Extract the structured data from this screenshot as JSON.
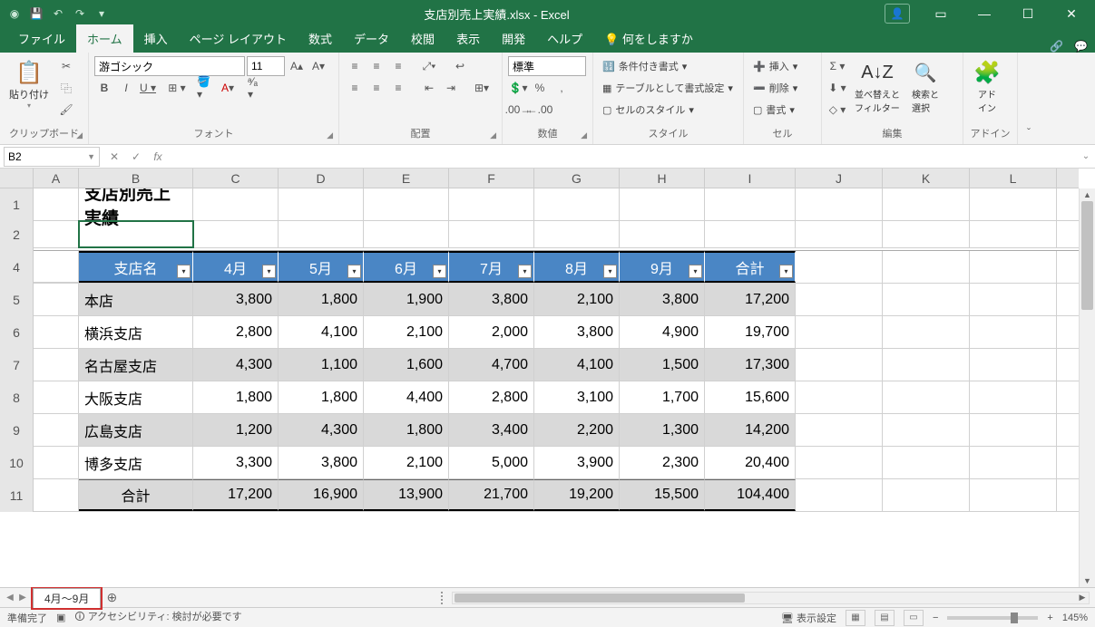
{
  "titlebar": {
    "title": "支店別売上実績.xlsx - Excel"
  },
  "tabs": {
    "items": [
      "ファイル",
      "ホーム",
      "挿入",
      "ページ レイアウト",
      "数式",
      "データ",
      "校閲",
      "表示",
      "開発",
      "ヘルプ"
    ],
    "active_index": 1,
    "tell_me": "何をしますか"
  },
  "ribbon": {
    "clipboard": {
      "label": "クリップボード",
      "paste": "貼り付け"
    },
    "font": {
      "label": "フォント",
      "name": "游ゴシック",
      "size": "11"
    },
    "alignment": {
      "label": "配置"
    },
    "number": {
      "label": "数値",
      "format": "標準"
    },
    "styles": {
      "label": "スタイル",
      "conditional": "条件付き書式",
      "as_table": "テーブルとして書式設定",
      "cell_styles": "セルのスタイル"
    },
    "cells": {
      "label": "セル",
      "insert": "挿入",
      "delete": "削除",
      "format": "書式"
    },
    "editing": {
      "label": "編集",
      "sort": "並べ替えと\nフィルター",
      "find": "検索と\n選択"
    },
    "addin": {
      "label": "アドイン",
      "text": "アド\nイン"
    }
  },
  "namebox": "B2",
  "columns": [
    "A",
    "B",
    "C",
    "D",
    "E",
    "F",
    "G",
    "H",
    "I",
    "J",
    "K",
    "L"
  ],
  "rows_visible": [
    "1",
    "2",
    "4",
    "5",
    "6",
    "7",
    "8",
    "9",
    "10",
    "11"
  ],
  "sheet_title": "支店別売上実績",
  "table": {
    "headers": [
      "支店名",
      "4月",
      "5月",
      "6月",
      "7月",
      "8月",
      "9月",
      "合計"
    ],
    "rows": [
      {
        "name": "本店",
        "vals": [
          "3,800",
          "1,800",
          "1,900",
          "3,800",
          "2,100",
          "3,800",
          "17,200"
        ]
      },
      {
        "name": "横浜支店",
        "vals": [
          "2,800",
          "4,100",
          "2,100",
          "2,000",
          "3,800",
          "4,900",
          "19,700"
        ]
      },
      {
        "name": "名古屋支店",
        "vals": [
          "4,300",
          "1,100",
          "1,600",
          "4,700",
          "4,100",
          "1,500",
          "17,300"
        ]
      },
      {
        "name": "大阪支店",
        "vals": [
          "1,800",
          "1,800",
          "4,400",
          "2,800",
          "3,100",
          "1,700",
          "15,600"
        ]
      },
      {
        "name": "広島支店",
        "vals": [
          "1,200",
          "4,300",
          "1,800",
          "3,400",
          "2,200",
          "1,300",
          "14,200"
        ]
      },
      {
        "name": "博多支店",
        "vals": [
          "3,300",
          "3,800",
          "2,100",
          "5,000",
          "3,900",
          "2,300",
          "20,400"
        ]
      }
    ],
    "total": {
      "name": "合計",
      "vals": [
        "17,200",
        "16,900",
        "13,900",
        "21,700",
        "19,200",
        "15,500",
        "104,400"
      ]
    }
  },
  "sheet_tabs": {
    "active": "4月～9月"
  },
  "status": {
    "ready": "準備完了",
    "accessibility": "アクセシビリティ: 検討が必要です",
    "display_settings": "表示設定",
    "zoom": "145%"
  }
}
